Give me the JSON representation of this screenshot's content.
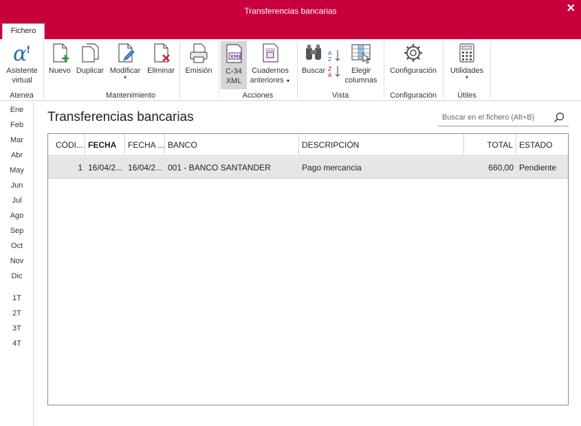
{
  "window": {
    "title": "Transferencias bancarias",
    "close": "✕"
  },
  "tabs": [
    {
      "label": "Fichero",
      "active": true
    }
  ],
  "ribbon": {
    "atenea": {
      "label": "Atenea",
      "asistente": [
        "Asistente",
        "virtual"
      ]
    },
    "mantenimiento": {
      "label": "Mantenimiento",
      "nuevo": "Nuevo",
      "duplicar": "Duplicar",
      "modificar": "Modificar",
      "eliminar": "Eliminar",
      "emision": "Emisión"
    },
    "acciones": {
      "label": "Acciones",
      "c34": [
        "C-34",
        "XML"
      ],
      "cuadernos": [
        "Cuadernos",
        "anteriores"
      ]
    },
    "vista": {
      "label": "Vista",
      "buscar": "Buscar",
      "elegir": [
        "Elegir",
        "columnas"
      ]
    },
    "configuracion": {
      "label": "Configuración",
      "config": "Configuración"
    },
    "utiles": {
      "label": "Útiles",
      "utilidades": "Utilidades"
    }
  },
  "sidebar": {
    "months": [
      "Ene",
      "Feb",
      "Mar",
      "Abr",
      "May",
      "Jun",
      "Jul",
      "Ago",
      "Sep",
      "Oct",
      "Nov",
      "Dic"
    ],
    "quarters": [
      "1T",
      "2T",
      "3T",
      "4T"
    ]
  },
  "main": {
    "title": "Transferencias bancarias",
    "search_placeholder": "Buscar en el fichero (Alt+B)"
  },
  "table": {
    "columns": [
      "CÓDI...",
      "FECHA",
      "FECHA ...",
      "BANCO",
      "DESCRIPCIÓN",
      "TOTAL",
      "ESTADO"
    ],
    "rows": [
      [
        "1",
        "16/04/2...",
        "16/04/2...",
        "001 - BANCO SANTANDER",
        "Pago mercancia",
        "660,00",
        "Pendiente"
      ]
    ]
  },
  "colors": {
    "accent": "#c8003c",
    "selected_row": "#e6e6e6"
  }
}
